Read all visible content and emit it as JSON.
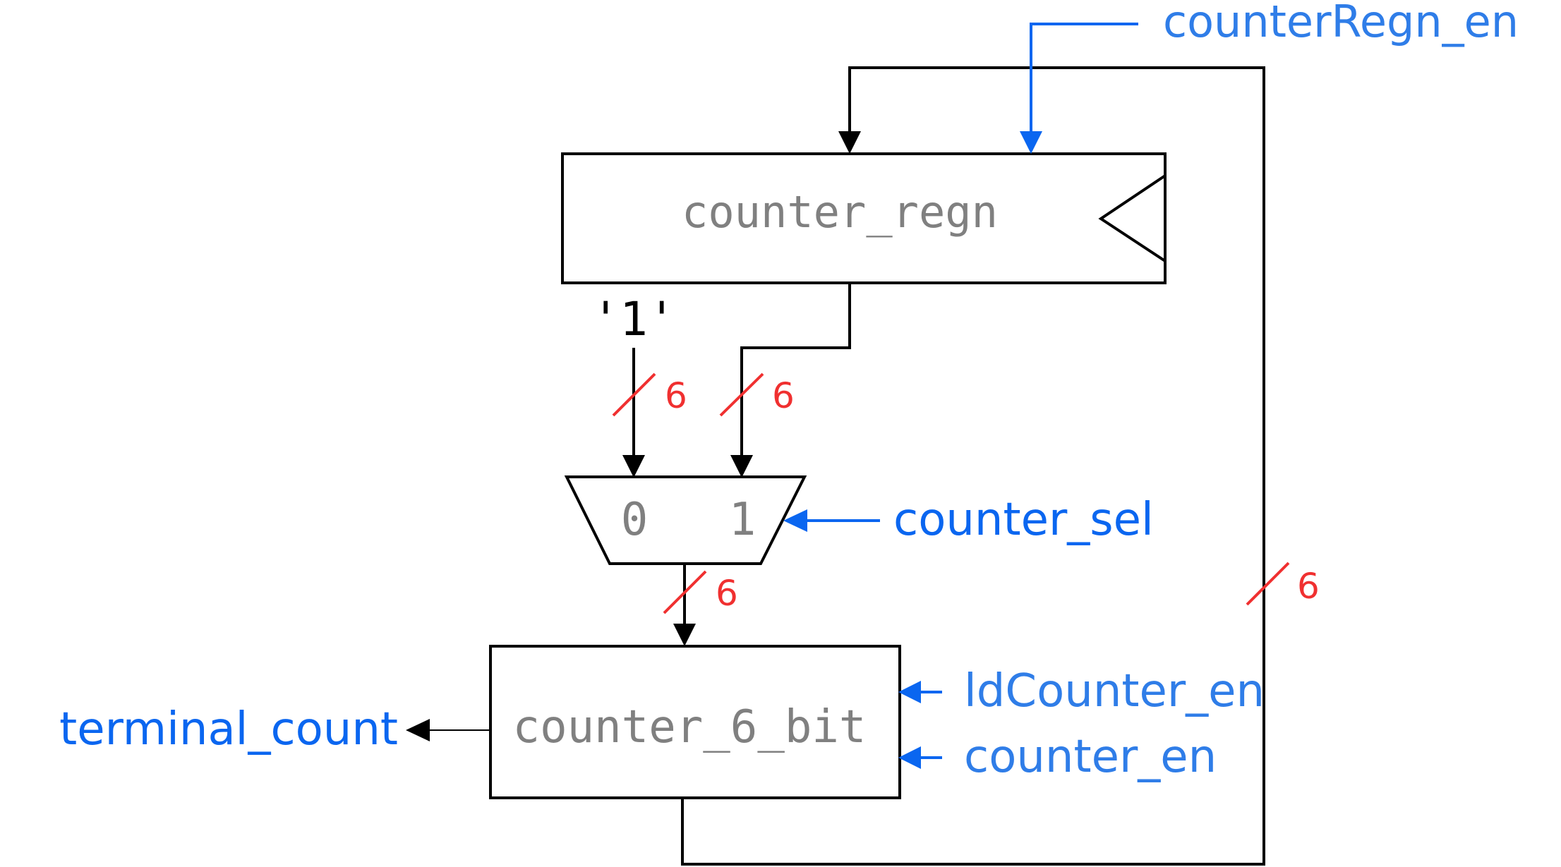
{
  "colors": {
    "wire": "#000000",
    "control": "#0a66f0",
    "label_control": "#2f7de8",
    "block_text": "#808080",
    "bus_width": "#f03030"
  },
  "blocks": {
    "counter_regn": "counter_regn",
    "counter_6_bit": "counter_6_bit"
  },
  "mux": {
    "input_0": "0",
    "input_1": "1"
  },
  "constant_input": "'1'",
  "signals": {
    "counterRegn_en": "counterRegn_en",
    "counter_sel": "counter_sel",
    "ldCounter_en": "ldCounter_en",
    "counter_en": "counter_en",
    "terminal_count": "terminal_count"
  },
  "bus_widths": {
    "const_to_mux": "6",
    "regn_to_mux": "6",
    "mux_to_counter": "6",
    "feedback": "6"
  }
}
